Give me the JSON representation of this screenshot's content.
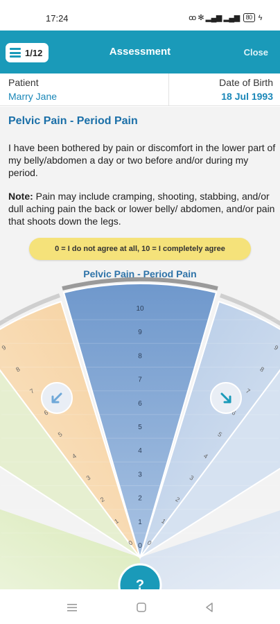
{
  "status": {
    "time": "17:24",
    "signal": "Ⓡ ⋮ ▮▮▮ ▮▮▮",
    "battery": "80"
  },
  "header": {
    "page_counter": "1/12",
    "title": "Assessment",
    "close_label": "Close"
  },
  "patient": {
    "label": "Patient",
    "name": "Marry Jane",
    "dob_label": "Date of Birth",
    "dob": "18 Jul 1993"
  },
  "section": {
    "title": "Pelvic Pain - Period Pain",
    "question": "I have been bothered by pain or discomfort in the lower part of my belly/abdomen a day or two before and/or during my period.",
    "note_label": "Note:",
    "note_text": " Pain may include cramping, shooting, stabbing, and/or dull aching pain the back or lower belly/ abdomen, and/or pain that shoots down the legs.",
    "scale_hint": "0 = I do not agree at all, 10 = I completely agree"
  },
  "wheel": {
    "title": "Pelvic Pain - Period Pain",
    "scale_labels": [
      "0",
      "1",
      "2",
      "3",
      "4",
      "5",
      "6",
      "7",
      "8",
      "9",
      "10"
    ],
    "help_label": "?",
    "colors": {
      "center": "#7ea4d4",
      "right": "#b9cde6",
      "left": "#f6d4a4",
      "far_left": "#d8e8b8"
    }
  },
  "nav": {
    "menu_icon": "recent-apps-icon",
    "home_icon": "home-icon",
    "back_icon": "back-icon"
  }
}
